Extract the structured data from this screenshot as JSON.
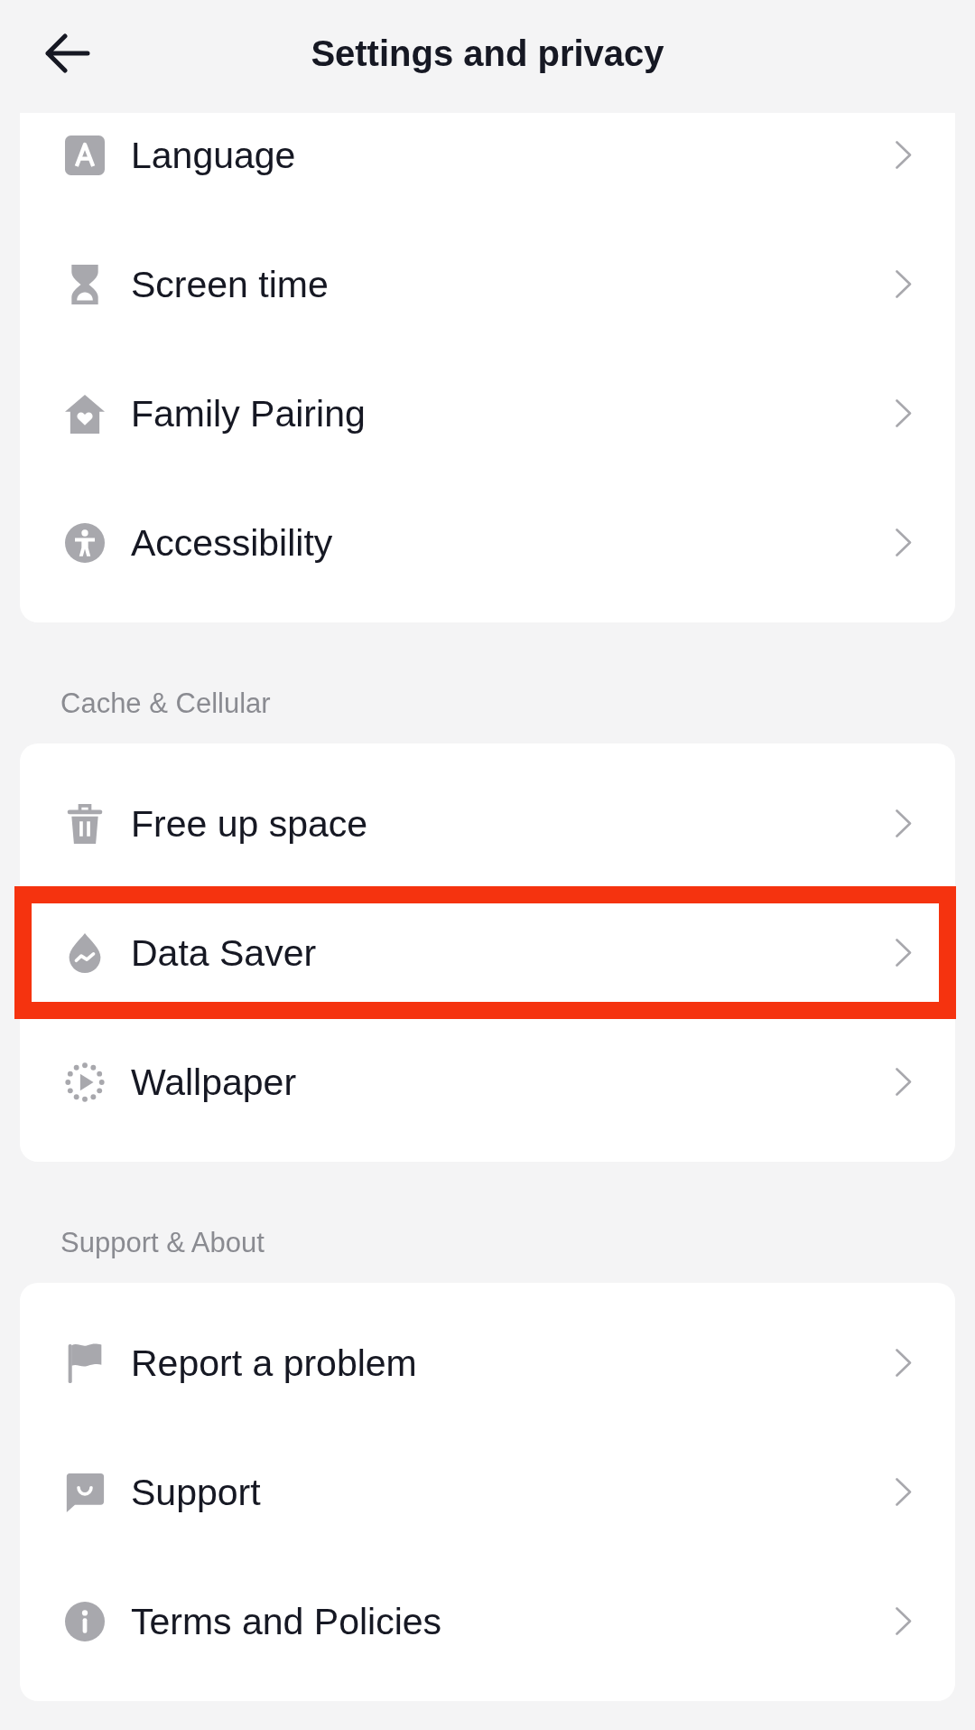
{
  "header": {
    "title": "Settings and privacy"
  },
  "groups": [
    {
      "items": [
        {
          "label": "Language",
          "highlighted": false
        },
        {
          "label": "Screen time",
          "highlighted": false
        },
        {
          "label": "Family Pairing",
          "highlighted": false
        },
        {
          "label": "Accessibility",
          "highlighted": false
        }
      ]
    },
    {
      "title": "Cache & Cellular",
      "items": [
        {
          "label": "Free up space",
          "highlighted": false
        },
        {
          "label": "Data Saver",
          "highlighted": true
        },
        {
          "label": "Wallpaper",
          "highlighted": false
        }
      ]
    },
    {
      "title": "Support & About",
      "items": [
        {
          "label": "Report a problem",
          "highlighted": false
        },
        {
          "label": "Support",
          "highlighted": false
        },
        {
          "label": "Terms and Policies",
          "highlighted": false
        }
      ]
    }
  ]
}
